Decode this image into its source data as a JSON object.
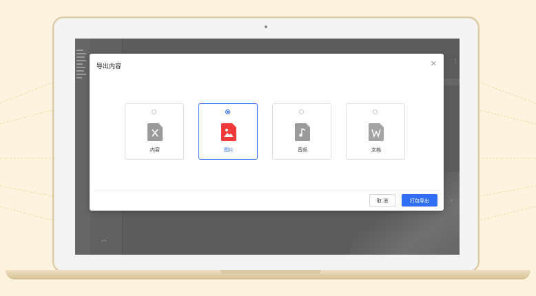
{
  "colors": {
    "background": "#fdf3df",
    "accent": "#2f6ef5",
    "image_icon": "#f23a3a",
    "gray_icon": "#9a9a9a"
  },
  "dialog": {
    "title": "导出内容",
    "close_icon": "close-icon",
    "options": [
      {
        "label": "内容",
        "icon": "excel-file-icon",
        "selected": false
      },
      {
        "label": "图片",
        "icon": "image-file-icon",
        "selected": true
      },
      {
        "label": "音频",
        "icon": "audio-file-icon",
        "selected": false
      },
      {
        "label": "文档",
        "icon": "word-file-icon",
        "selected": false
      }
    ],
    "cancel_label": "取 消",
    "confirm_label": "打包导出"
  }
}
